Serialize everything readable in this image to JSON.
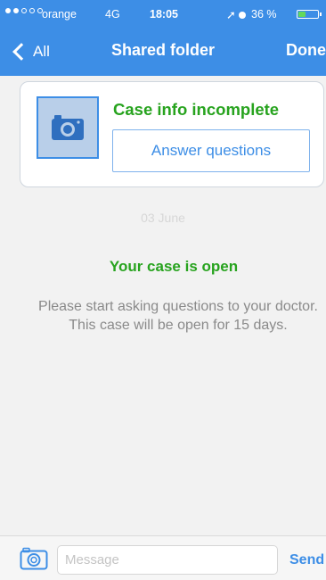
{
  "status_bar": {
    "carrier": "orange",
    "network": "4G",
    "time": "18:05",
    "battery_percent": "36 %",
    "battery_level": 0.36,
    "signal_bars_filled": 2,
    "signal_bars_total": 5
  },
  "nav": {
    "back_label": "All",
    "title": "Shared folder",
    "done_label": "Done"
  },
  "case_card": {
    "title": "Case info incomplete",
    "button_label": "Answer questions",
    "photo_icon": "camera-icon"
  },
  "conversation": {
    "date": "03 June",
    "status_title": "Your case is open",
    "info": "Please start asking questions to your doctor.  This case will be open for 15 days."
  },
  "composer": {
    "attach_icon": "camera-icon",
    "placeholder": "Message",
    "value": "",
    "send_label": "Send"
  },
  "colors": {
    "accent": "#3d8ee6",
    "success": "#27a31e",
    "muted_text": "#8a8a8a",
    "background": "#f2f2f2"
  }
}
